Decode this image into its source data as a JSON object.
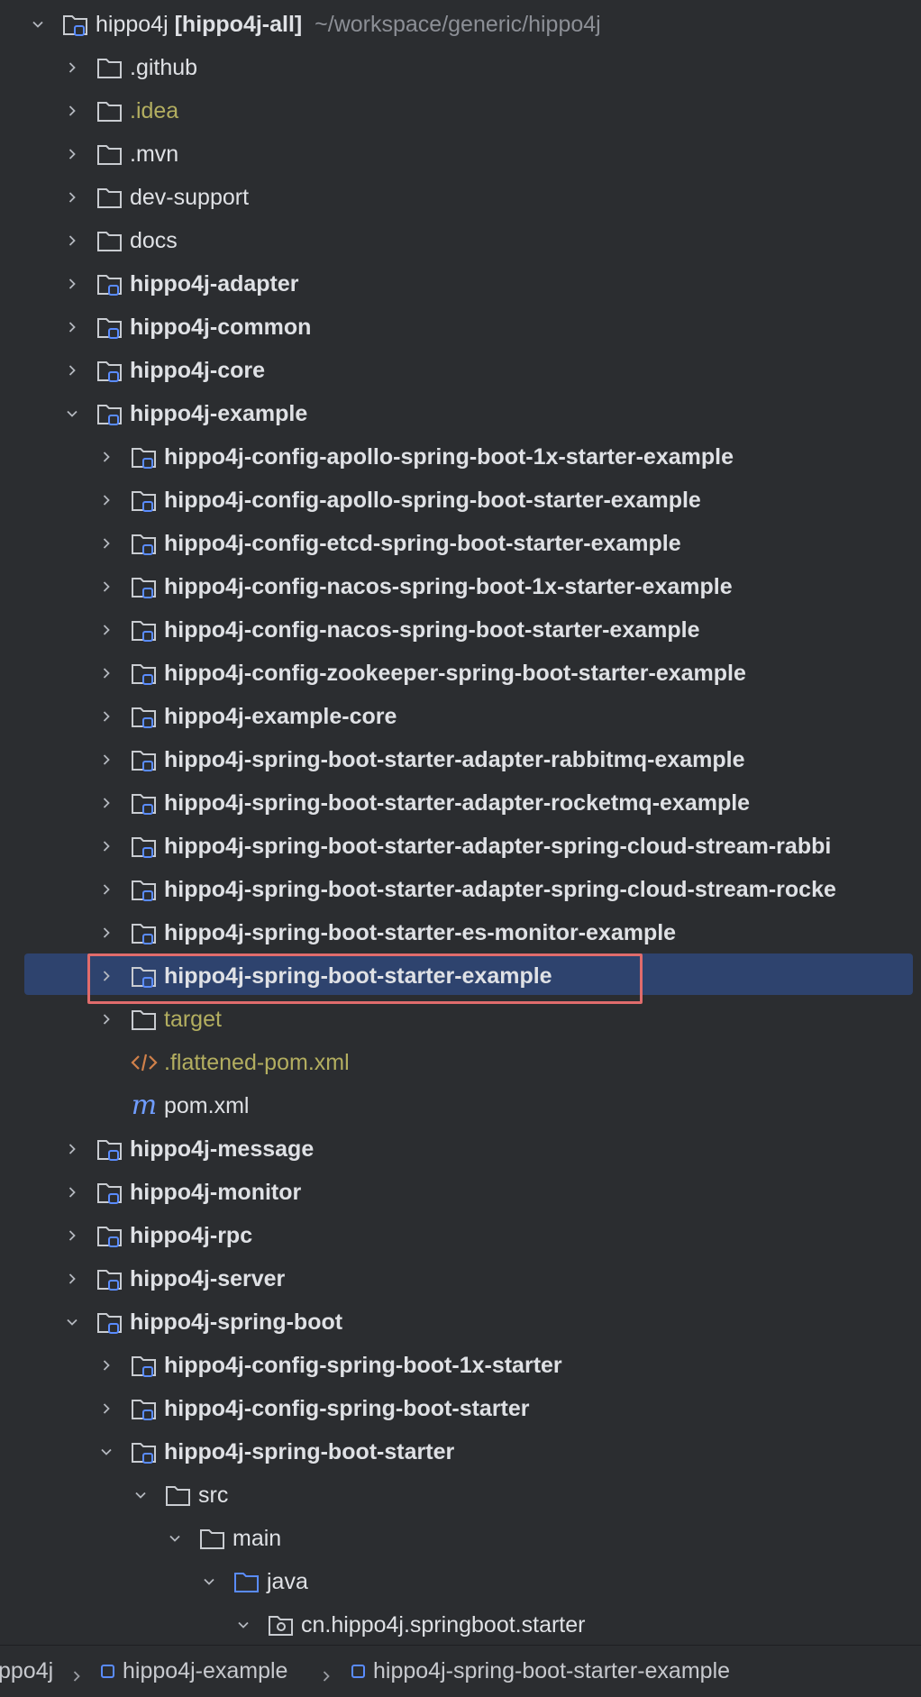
{
  "tree": {
    "root": {
      "name": "hippo4j",
      "module": "[hippo4j-all]",
      "path": "~/workspace/generic/hippo4j"
    },
    "items": [
      {
        "label": ".github",
        "type": "folder"
      },
      {
        "label": ".idea",
        "type": "folder",
        "style": "olive"
      },
      {
        "label": ".mvn",
        "type": "folder"
      },
      {
        "label": "dev-support",
        "type": "folder"
      },
      {
        "label": "docs",
        "type": "folder"
      },
      {
        "label": "hippo4j-adapter",
        "type": "module"
      },
      {
        "label": "hippo4j-common",
        "type": "module"
      },
      {
        "label": "hippo4j-core",
        "type": "module"
      },
      {
        "label": "hippo4j-example",
        "type": "module",
        "expanded": true
      },
      {
        "label": "hippo4j-config-apollo-spring-boot-1x-starter-example",
        "type": "module"
      },
      {
        "label": "hippo4j-config-apollo-spring-boot-starter-example",
        "type": "module"
      },
      {
        "label": "hippo4j-config-etcd-spring-boot-starter-example",
        "type": "module"
      },
      {
        "label": "hippo4j-config-nacos-spring-boot-1x-starter-example",
        "type": "module"
      },
      {
        "label": "hippo4j-config-nacos-spring-boot-starter-example",
        "type": "module"
      },
      {
        "label": "hippo4j-config-zookeeper-spring-boot-starter-example",
        "type": "module"
      },
      {
        "label": "hippo4j-example-core",
        "type": "module"
      },
      {
        "label": "hippo4j-spring-boot-starter-adapter-rabbitmq-example",
        "type": "module"
      },
      {
        "label": "hippo4j-spring-boot-starter-adapter-rocketmq-example",
        "type": "module"
      },
      {
        "label": "hippo4j-spring-boot-starter-adapter-spring-cloud-stream-rabbi",
        "type": "module"
      },
      {
        "label": "hippo4j-spring-boot-starter-adapter-spring-cloud-stream-rocke",
        "type": "module"
      },
      {
        "label": "hippo4j-spring-boot-starter-es-monitor-example",
        "type": "module"
      },
      {
        "label": "hippo4j-spring-boot-starter-example",
        "type": "module",
        "selected": true
      },
      {
        "label": "target",
        "type": "folder",
        "style": "olive"
      },
      {
        "label": ".flattened-pom.xml",
        "type": "xml",
        "style": "olive"
      },
      {
        "label": "pom.xml",
        "type": "maven"
      },
      {
        "label": "hippo4j-message",
        "type": "module"
      },
      {
        "label": "hippo4j-monitor",
        "type": "module"
      },
      {
        "label": "hippo4j-rpc",
        "type": "module"
      },
      {
        "label": "hippo4j-server",
        "type": "module"
      },
      {
        "label": "hippo4j-spring-boot",
        "type": "module",
        "expanded": true
      },
      {
        "label": "hippo4j-config-spring-boot-1x-starter",
        "type": "module"
      },
      {
        "label": "hippo4j-config-spring-boot-starter",
        "type": "module"
      },
      {
        "label": "hippo4j-spring-boot-starter",
        "type": "module",
        "expanded": true
      },
      {
        "label": "src",
        "type": "folder",
        "expanded": true
      },
      {
        "label": "main",
        "type": "folder",
        "expanded": true
      },
      {
        "label": "java",
        "type": "source-folder",
        "expanded": true
      },
      {
        "label": "cn.hippo4j.springboot.starter",
        "type": "package",
        "expanded": true
      }
    ]
  },
  "breadcrumb": {
    "items": [
      "ppo4j",
      "hippo4j-example",
      "hippo4j-spring-boot-starter-example"
    ]
  },
  "colors": {
    "background": "#2b2d30",
    "selection": "#2e436e",
    "highlight_outline": "#e06c6c",
    "olive_text": "#b3ae60",
    "module_badge": "#5a8cff"
  }
}
